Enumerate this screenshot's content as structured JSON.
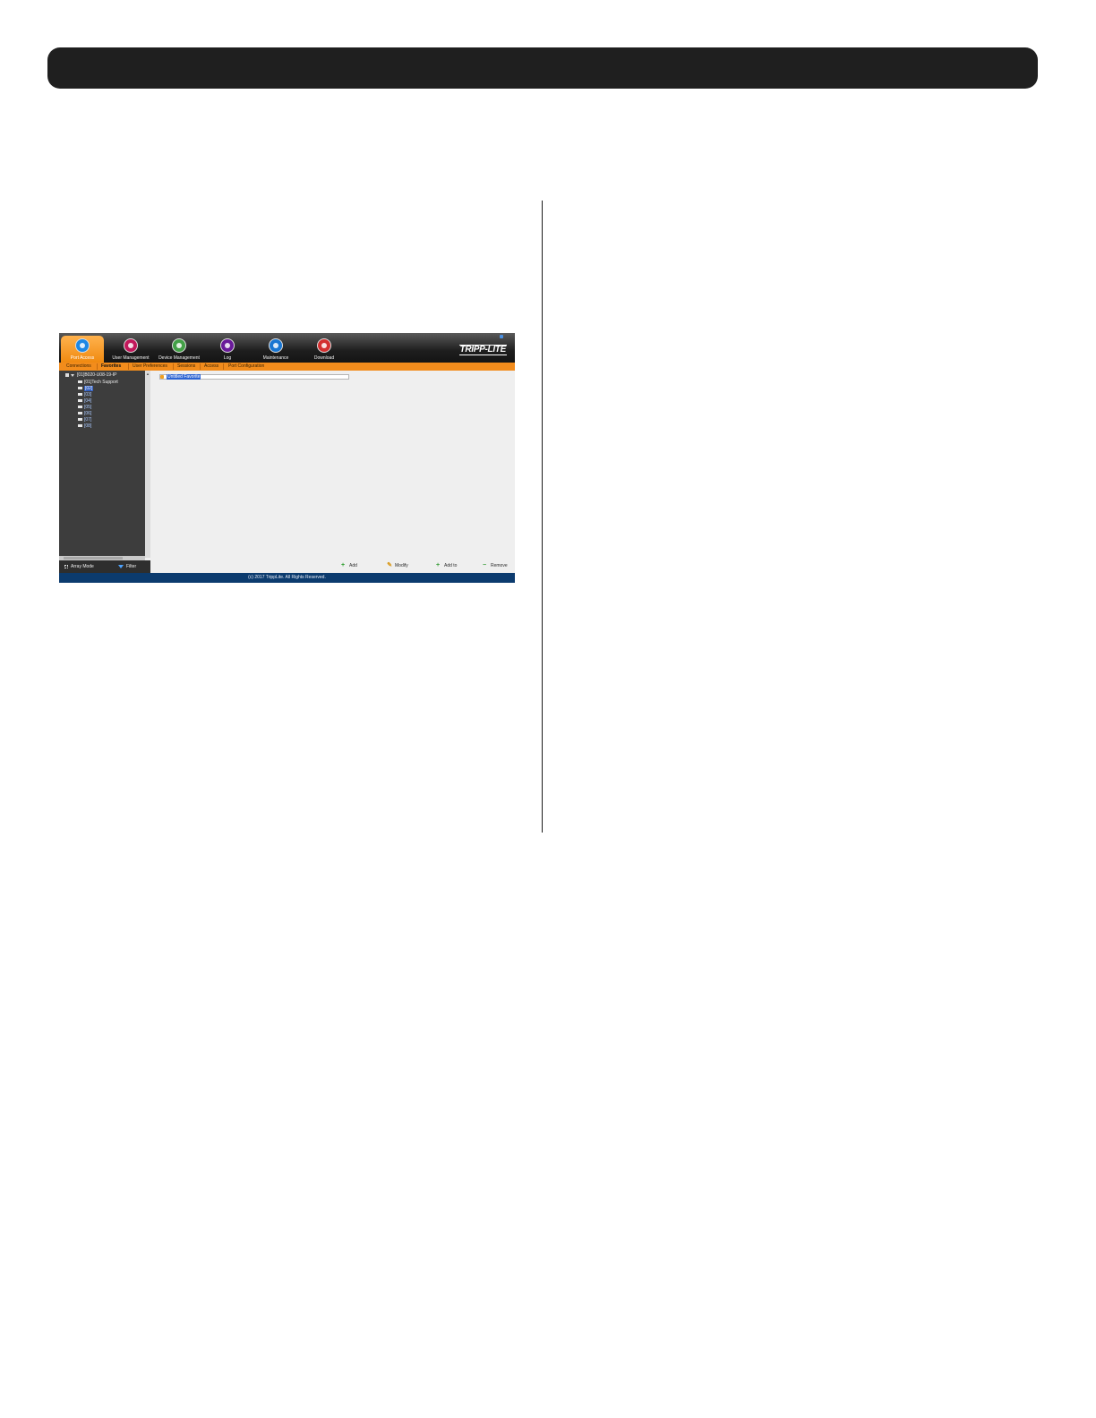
{
  "app": {
    "nav": [
      {
        "label": "Port Access",
        "icon": "port-access-icon",
        "color": "#1e88e5",
        "active": true
      },
      {
        "label": "User Management",
        "icon": "user-management-icon",
        "color": "#c2185b",
        "active": false
      },
      {
        "label": "Device Management",
        "icon": "device-management-icon",
        "color": "#43a047",
        "active": false
      },
      {
        "label": "Log",
        "icon": "log-icon",
        "color": "#6a1b9a",
        "active": false
      },
      {
        "label": "Maintenance",
        "icon": "maintenance-icon",
        "color": "#1976d2",
        "active": false
      },
      {
        "label": "Download",
        "icon": "download-icon",
        "color": "#d32f2f",
        "active": false
      }
    ],
    "logo": "TRIPP-LITE",
    "subnav": [
      {
        "label": "Connections",
        "active": false
      },
      {
        "label": "Favorites",
        "active": true
      },
      {
        "label": "User Preferences",
        "active": false
      },
      {
        "label": "Sessions",
        "active": false
      },
      {
        "label": "Access",
        "active": false
      },
      {
        "label": "Port Configuration",
        "active": false
      }
    ],
    "tree": {
      "root": "[01]B020-U08-19-IP",
      "ports": [
        "[01]Tech Support",
        "[02]",
        "[03]",
        "[04]",
        "[05]",
        "[06]",
        "[07]",
        "[08]"
      ],
      "selected_index": 1
    },
    "favorite": {
      "label": "Untitled Favorite"
    },
    "bottom_left": {
      "array_mode": "Array Mode",
      "filter": "Filter"
    },
    "actions": {
      "add": "Add",
      "modify": "Modify",
      "add_to": "Add to",
      "remove": "Remove"
    },
    "footer": "(c) 2017 TrippLite. All Rights Reserved."
  }
}
